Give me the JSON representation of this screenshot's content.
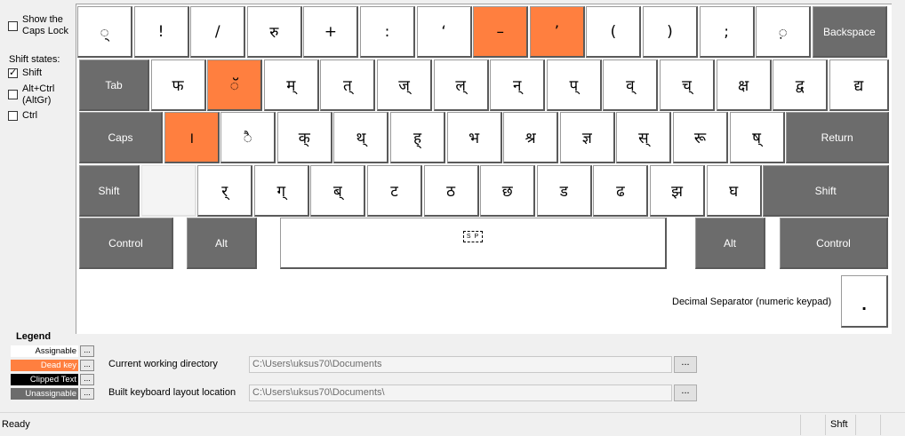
{
  "options": {
    "caps_lock_label": "Show the\nCaps Lock",
    "shift_states_title": "Shift states:",
    "shift_label": "Shift",
    "altgr_label": "Alt+Ctrl\n(AltGr)",
    "ctrl_label": "Ctrl",
    "shift_checked": true
  },
  "rows": [
    [
      {
        "label": "◌्",
        "type": "normal"
      },
      {
        "label": "!",
        "type": "normal"
      },
      {
        "label": "/",
        "type": "normal"
      },
      {
        "label": "रु",
        "type": "normal"
      },
      {
        "label": "+",
        "type": "normal"
      },
      {
        "label": ":",
        "type": "normal"
      },
      {
        "label": "‘",
        "type": "normal"
      },
      {
        "label": "–",
        "type": "dead"
      },
      {
        "label": "’",
        "type": "dead"
      },
      {
        "label": "(",
        "type": "normal"
      },
      {
        "label": ")",
        "type": "normal"
      },
      {
        "label": ";",
        "type": "normal"
      },
      {
        "label": "◌़",
        "type": "normal"
      },
      {
        "label": "Backspace",
        "type": "unassignable"
      }
    ],
    [
      {
        "label": "Tab",
        "type": "unassignable"
      },
      {
        "label": "फ",
        "type": "normal"
      },
      {
        "label": "◌ॅ",
        "type": "dead"
      },
      {
        "label": "म्",
        "type": "normal"
      },
      {
        "label": "त्",
        "type": "normal"
      },
      {
        "label": "ज्",
        "type": "normal"
      },
      {
        "label": "ल्",
        "type": "normal"
      },
      {
        "label": "न्",
        "type": "normal"
      },
      {
        "label": "प्",
        "type": "normal"
      },
      {
        "label": "व्",
        "type": "normal"
      },
      {
        "label": "च्",
        "type": "normal"
      },
      {
        "label": "क्ष",
        "type": "normal"
      },
      {
        "label": "द्व",
        "type": "normal"
      },
      {
        "label": "द्य",
        "type": "normal"
      }
    ],
    [
      {
        "label": "Caps",
        "type": "unassignable"
      },
      {
        "label": "।",
        "type": "dead"
      },
      {
        "label": "◌ै",
        "type": "normal"
      },
      {
        "label": "क्",
        "type": "normal"
      },
      {
        "label": "थ्",
        "type": "normal"
      },
      {
        "label": "ह्",
        "type": "normal"
      },
      {
        "label": "भ",
        "type": "normal"
      },
      {
        "label": "श्र",
        "type": "normal"
      },
      {
        "label": "ज्ञ",
        "type": "normal"
      },
      {
        "label": "स्",
        "type": "normal"
      },
      {
        "label": "रू",
        "type": "normal"
      },
      {
        "label": "ष्",
        "type": "normal"
      },
      {
        "label": "Return",
        "type": "unassignable"
      }
    ],
    [
      {
        "label": "Shift",
        "type": "unassignable"
      },
      {
        "label": "",
        "type": "blank"
      },
      {
        "label": "र्",
        "type": "normal"
      },
      {
        "label": "ग्",
        "type": "normal"
      },
      {
        "label": "ब्",
        "type": "normal"
      },
      {
        "label": "ट",
        "type": "normal"
      },
      {
        "label": "ठ",
        "type": "normal"
      },
      {
        "label": "छ",
        "type": "normal"
      },
      {
        "label": "ड",
        "type": "normal"
      },
      {
        "label": "ढ",
        "type": "normal"
      },
      {
        "label": "झ",
        "type": "normal"
      },
      {
        "label": "घ",
        "type": "normal"
      },
      {
        "label": "Shift",
        "type": "unassignable"
      }
    ],
    [
      {
        "label": "Control",
        "type": "unassignable"
      },
      {
        "label": "Alt",
        "type": "unassignable"
      },
      {
        "label": "S P",
        "type": "space"
      },
      {
        "label": "Alt",
        "type": "unassignable"
      },
      {
        "label": "Control",
        "type": "unassignable"
      }
    ]
  ],
  "decimal": {
    "label": "Decimal Separator (numeric keypad)",
    "key": "."
  },
  "legend": {
    "title": "Legend",
    "items": [
      {
        "label": "Assignable",
        "bg": "#ffffff",
        "fg": "#000000"
      },
      {
        "label": "Dead key",
        "bg": "#ff7f3f",
        "fg": "#ffffff"
      },
      {
        "label": "Clipped Text",
        "bg": "#000000",
        "fg": "#ffffff"
      },
      {
        "label": "Unassignable",
        "bg": "#6c6c6c",
        "fg": "#ffffff"
      }
    ],
    "dots": "..."
  },
  "directories": {
    "cwd_label": "Current working directory",
    "cwd_value": "C:\\Users\\uksus70\\Documents",
    "built_label": "Built keyboard layout location",
    "built_value": "C:\\Users\\uksus70\\Documents\\",
    "browse": "..."
  },
  "status": {
    "text": "Ready",
    "shift_indicator": "Shft"
  }
}
